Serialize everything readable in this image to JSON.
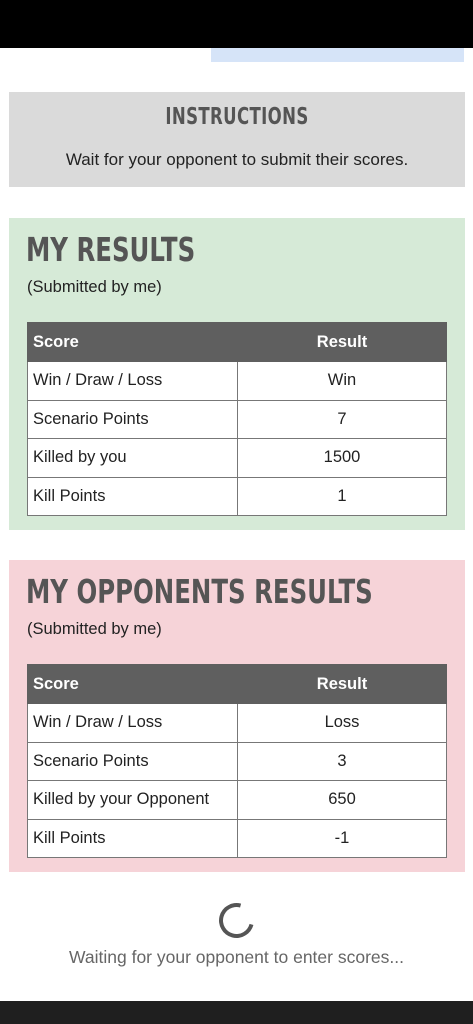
{
  "instructions": {
    "heading": "INSTRUCTIONS",
    "text": "Wait for your opponent to submit their scores."
  },
  "my_results": {
    "title": "MY RESULTS",
    "subtitle": "(Submitted by me)",
    "table": {
      "headers": [
        "Score",
        "Result"
      ],
      "rows": [
        {
          "label": "Win / Draw / Loss",
          "value": "Win"
        },
        {
          "label": "Scenario Points",
          "value": "7"
        },
        {
          "label": "Killed by you",
          "value": "1500"
        },
        {
          "label": "Kill Points",
          "value": "1"
        }
      ]
    }
  },
  "opponent_results": {
    "title": "MY OPPONENTS RESULTS",
    "subtitle": "(Submitted by me)",
    "table": {
      "headers": [
        "Score",
        "Result"
      ],
      "rows": [
        {
          "label": "Win / Draw / Loss",
          "value": "Loss"
        },
        {
          "label": "Scenario Points",
          "value": "3"
        },
        {
          "label": "Killed by your Opponent",
          "value": "650"
        },
        {
          "label": "Kill Points",
          "value": "-1"
        }
      ]
    }
  },
  "waiting": {
    "text": "Waiting for your opponent to enter scores..."
  },
  "colors": {
    "instructions_bg": "#dadada",
    "my_results_bg": "#d6ead7",
    "opponent_results_bg": "#f6d3d8",
    "table_header_bg": "#5f5f5f"
  }
}
